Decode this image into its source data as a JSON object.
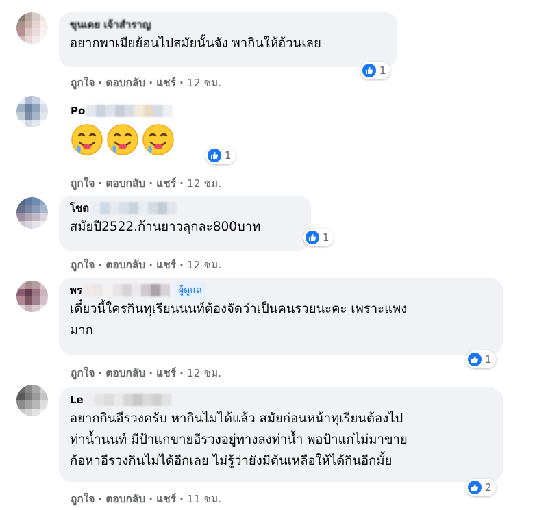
{
  "comments": [
    {
      "name": "ขุนเดย เจ้าสำราญ",
      "text_lines": [
        "อยากพาเมียย้อนไปสมัยนั้นจัง พากินให้อ้วนเลย"
      ],
      "like": "ถูกใจ",
      "reply": "ตอบกลับ",
      "share": "แชร์",
      "time": "12 ชม.",
      "reactions": "1",
      "avatar_colors": [
        "#8a7a72",
        "#b9a9a2",
        "#d8ccc8",
        "#efe6e4",
        "#a3918a",
        "#c8b2ab",
        "#e5d5d2",
        "#f5eeed",
        "#b98f92",
        "#d9c6c6",
        "#eadcdc",
        "#f7f1f1",
        "#d0b8bd",
        "#e6d7da",
        "#f2e9ea",
        "#fbf7f7"
      ]
    },
    {
      "name": "Po",
      "blur_colors": [
        "#e3e8ef",
        "#c9d2de",
        "#dfe3e9",
        "#c7cdd6",
        "#d7dce3",
        "#f3ead9",
        "#e8d9c6",
        "#d5dbe5",
        "#eef0f4"
      ],
      "emoji_count": 3,
      "like": "ถูกใจ",
      "reply": "ตอบกลับ",
      "share": "แชร์",
      "time": "12 ชม.",
      "reactions": "1",
      "avatar_colors": [
        "#e6ebf2",
        "#aebccf",
        "#c5d0df",
        "#eef2f7",
        "#9fb0c6",
        "#6f85a3",
        "#8fa2bc",
        "#d6dfe9",
        "#c2ccd9",
        "#7d8ea6",
        "#a6b4c7",
        "#e1e7ef",
        "#f1f4f8",
        "#d2dae5",
        "#e4e9f0",
        "#f7f9fb"
      ]
    },
    {
      "name": "โชต",
      "blur_colors": [
        "#e9eef5",
        "#cfd9e6",
        "#e4e9f0",
        "#d7dfe9",
        "#cad2dc",
        "#e8edf3",
        "#d5dbe3",
        "#c4ccd6",
        "#e2e6ec"
      ],
      "text_lines": [
        "สมัยปี2522.ก้านยาวลุกละ800บาท"
      ],
      "like": "ถูกใจ",
      "reply": "ตอบกลับ",
      "share": "แชร์",
      "time": "12 ชม.",
      "reactions": "1",
      "avatar_colors": [
        "#4d6a8f",
        "#5f7ca0",
        "#6d8bb0",
        "#8ea6c4",
        "#6b6f8a",
        "#7a86a3",
        "#8a9ab6",
        "#a8b7cc",
        "#9d8f9f",
        "#b1a4b4",
        "#c1b8c6",
        "#d8d4de",
        "#c8c3cd",
        "#d9d5de",
        "#e6e3ea",
        "#f1eff3"
      ]
    },
    {
      "name": "พร",
      "blur_colors": [
        "#f0e9e8",
        "#ece6e6",
        "#f4f1f1",
        "#e8e4e6",
        "#d9d3d8",
        "#ebe7ea",
        "#cfc8cd",
        "#aaa3a8",
        "#d8d2d6"
      ],
      "badge": "ผู้ดูแล",
      "text_lines": [
        "เดี๋ยวนี้ใครกินทุเรียนนนท์ต้องจัดว่าเป็นคนรวยนะคะ เพราะแพง",
        "มาก"
      ],
      "like": "ถูกใจ",
      "reply": "ตอบกลับ",
      "share": "แชร์",
      "time": "12 ชม.",
      "reactions": "1",
      "avatar_colors": [
        "#c2a7ab",
        "#a98d93",
        "#b59da2",
        "#d6c4c7",
        "#8a5d70",
        "#6a3d56",
        "#9b7483",
        "#c9b2b9",
        "#b08893",
        "#7d5668",
        "#a38390",
        "#d5c2c8",
        "#e0d2d5",
        "#c6b1b7",
        "#d8c8cd",
        "#efe6e8"
      ]
    },
    {
      "name": "Le",
      "blur_colors": [
        "#eeeeee",
        "#e4e4e4",
        "#dcdcdc",
        "#e9e9e9",
        "#d6d6d6",
        "#c8c8c8",
        "#d9d9d9",
        "#cfcfcf",
        "#e2e2e2"
      ],
      "text_lines": [
        "อยากกินอีรวงครับ หากินไม่ได้แล้ว สมัยก่อนหน้าทุเรียนต้องไป",
        "ท่าน้ำนนท์ มีป้าแกขายอีรวงอยู่ทางลงท่าน้ำ พอป้าแกไม่มาขาย",
        "ก้อหาอีรวงกินไม่ได้อีกเลย ไม่รู้ว่ายังมีต้นเหลือให้ได้กินอีกมั้ย"
      ],
      "like": "ถูกใจ",
      "reply": "ตอบกลับ",
      "share": "แชร์",
      "time": "11 ชม.",
      "reactions": "2",
      "avatar_colors": [
        "#6a6a6a",
        "#8a8a8a",
        "#a8a8a8",
        "#d0d0d0",
        "#5a5a5a",
        "#7a7a7a",
        "#9a9a9a",
        "#c4c4c4",
        "#8c8c8c",
        "#a2a2a2",
        "#b8b8b8",
        "#dedede",
        "#c8c8c8",
        "#d4d4d4",
        "#e2e2e2",
        "#f0f0f0"
      ]
    }
  ]
}
